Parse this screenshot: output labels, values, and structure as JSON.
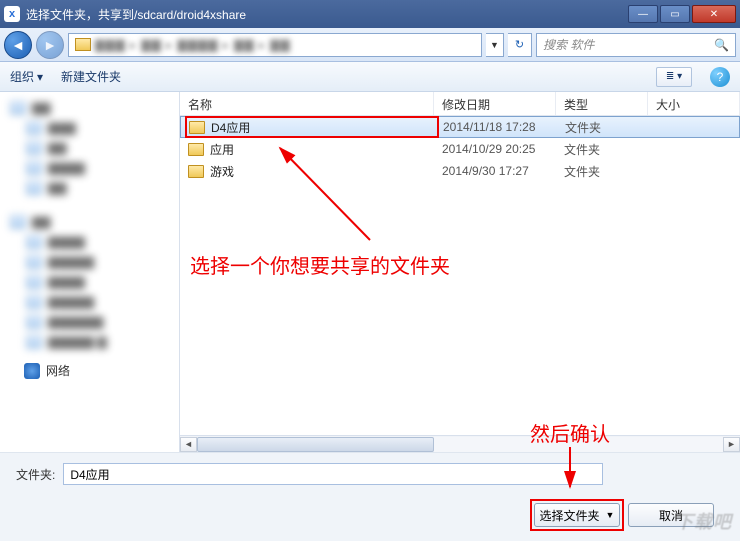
{
  "titlebar": {
    "app_icon_text": "x",
    "title": "选择文件夹，共享到/sdcard/droid4xshare"
  },
  "nav": {
    "breadcrumb_blur": "▇▇▇ ▸ ▇▇ ▸ ▇▇▇▇ ▸ ▇▇ ▸ ▇▇",
    "search_placeholder": "搜索 软件"
  },
  "toolbar": {
    "organize": "组织",
    "new_folder": "新建文件夹",
    "view_glyph": "≣ ▾",
    "help_glyph": "?"
  },
  "columns": {
    "name": "名称",
    "date": "修改日期",
    "type": "类型",
    "size": "大小"
  },
  "files": [
    {
      "name": "D4应用",
      "date": "2014/11/18 17:28",
      "type": "文件夹",
      "selected": true
    },
    {
      "name": "应用",
      "date": "2014/10/29 20:25",
      "type": "文件夹",
      "selected": false
    },
    {
      "name": "游戏",
      "date": "2014/9/30 17:27",
      "type": "文件夹",
      "selected": false
    }
  ],
  "sidebar": {
    "network": "网络"
  },
  "annotations": {
    "line1": "选择一个你想要共享的文件夹",
    "line2": "然后确认"
  },
  "bottom": {
    "folder_label": "文件夹:",
    "folder_value": "D4应用",
    "select_btn": "选择文件夹",
    "cancel_btn": "取消"
  },
  "watermark": "下载吧"
}
